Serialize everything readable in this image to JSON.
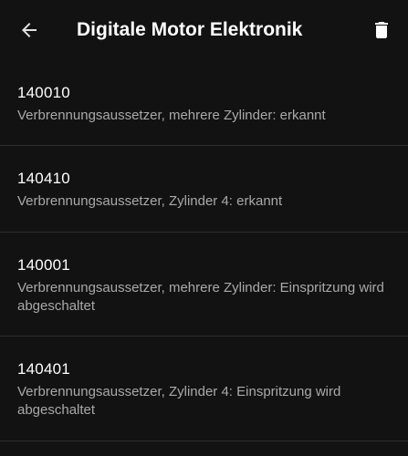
{
  "appbar": {
    "title": "Digitale Motor Elektronik",
    "back_icon": "arrow-back-icon",
    "delete_icon": "trash-icon"
  },
  "codes": [
    {
      "code": "140010",
      "description": "Verbrennungsaussetzer, mehrere Zylinder: erkannt"
    },
    {
      "code": "140410",
      "description": "Verbrennungsaussetzer, Zylinder 4: erkannt"
    },
    {
      "code": "140001",
      "description": "Verbrennungsaussetzer, mehrere Zylinder: Einspritzung wird abgeschaltet"
    },
    {
      "code": "140401",
      "description": "Verbrennungsaussetzer, Zylinder 4: Einspritzung wird abgeschaltet"
    }
  ],
  "colors": {
    "background": "#121212",
    "primary_text": "#ffffff",
    "secondary_text": "#a9a9a9",
    "divider": "#2e2e2e"
  }
}
